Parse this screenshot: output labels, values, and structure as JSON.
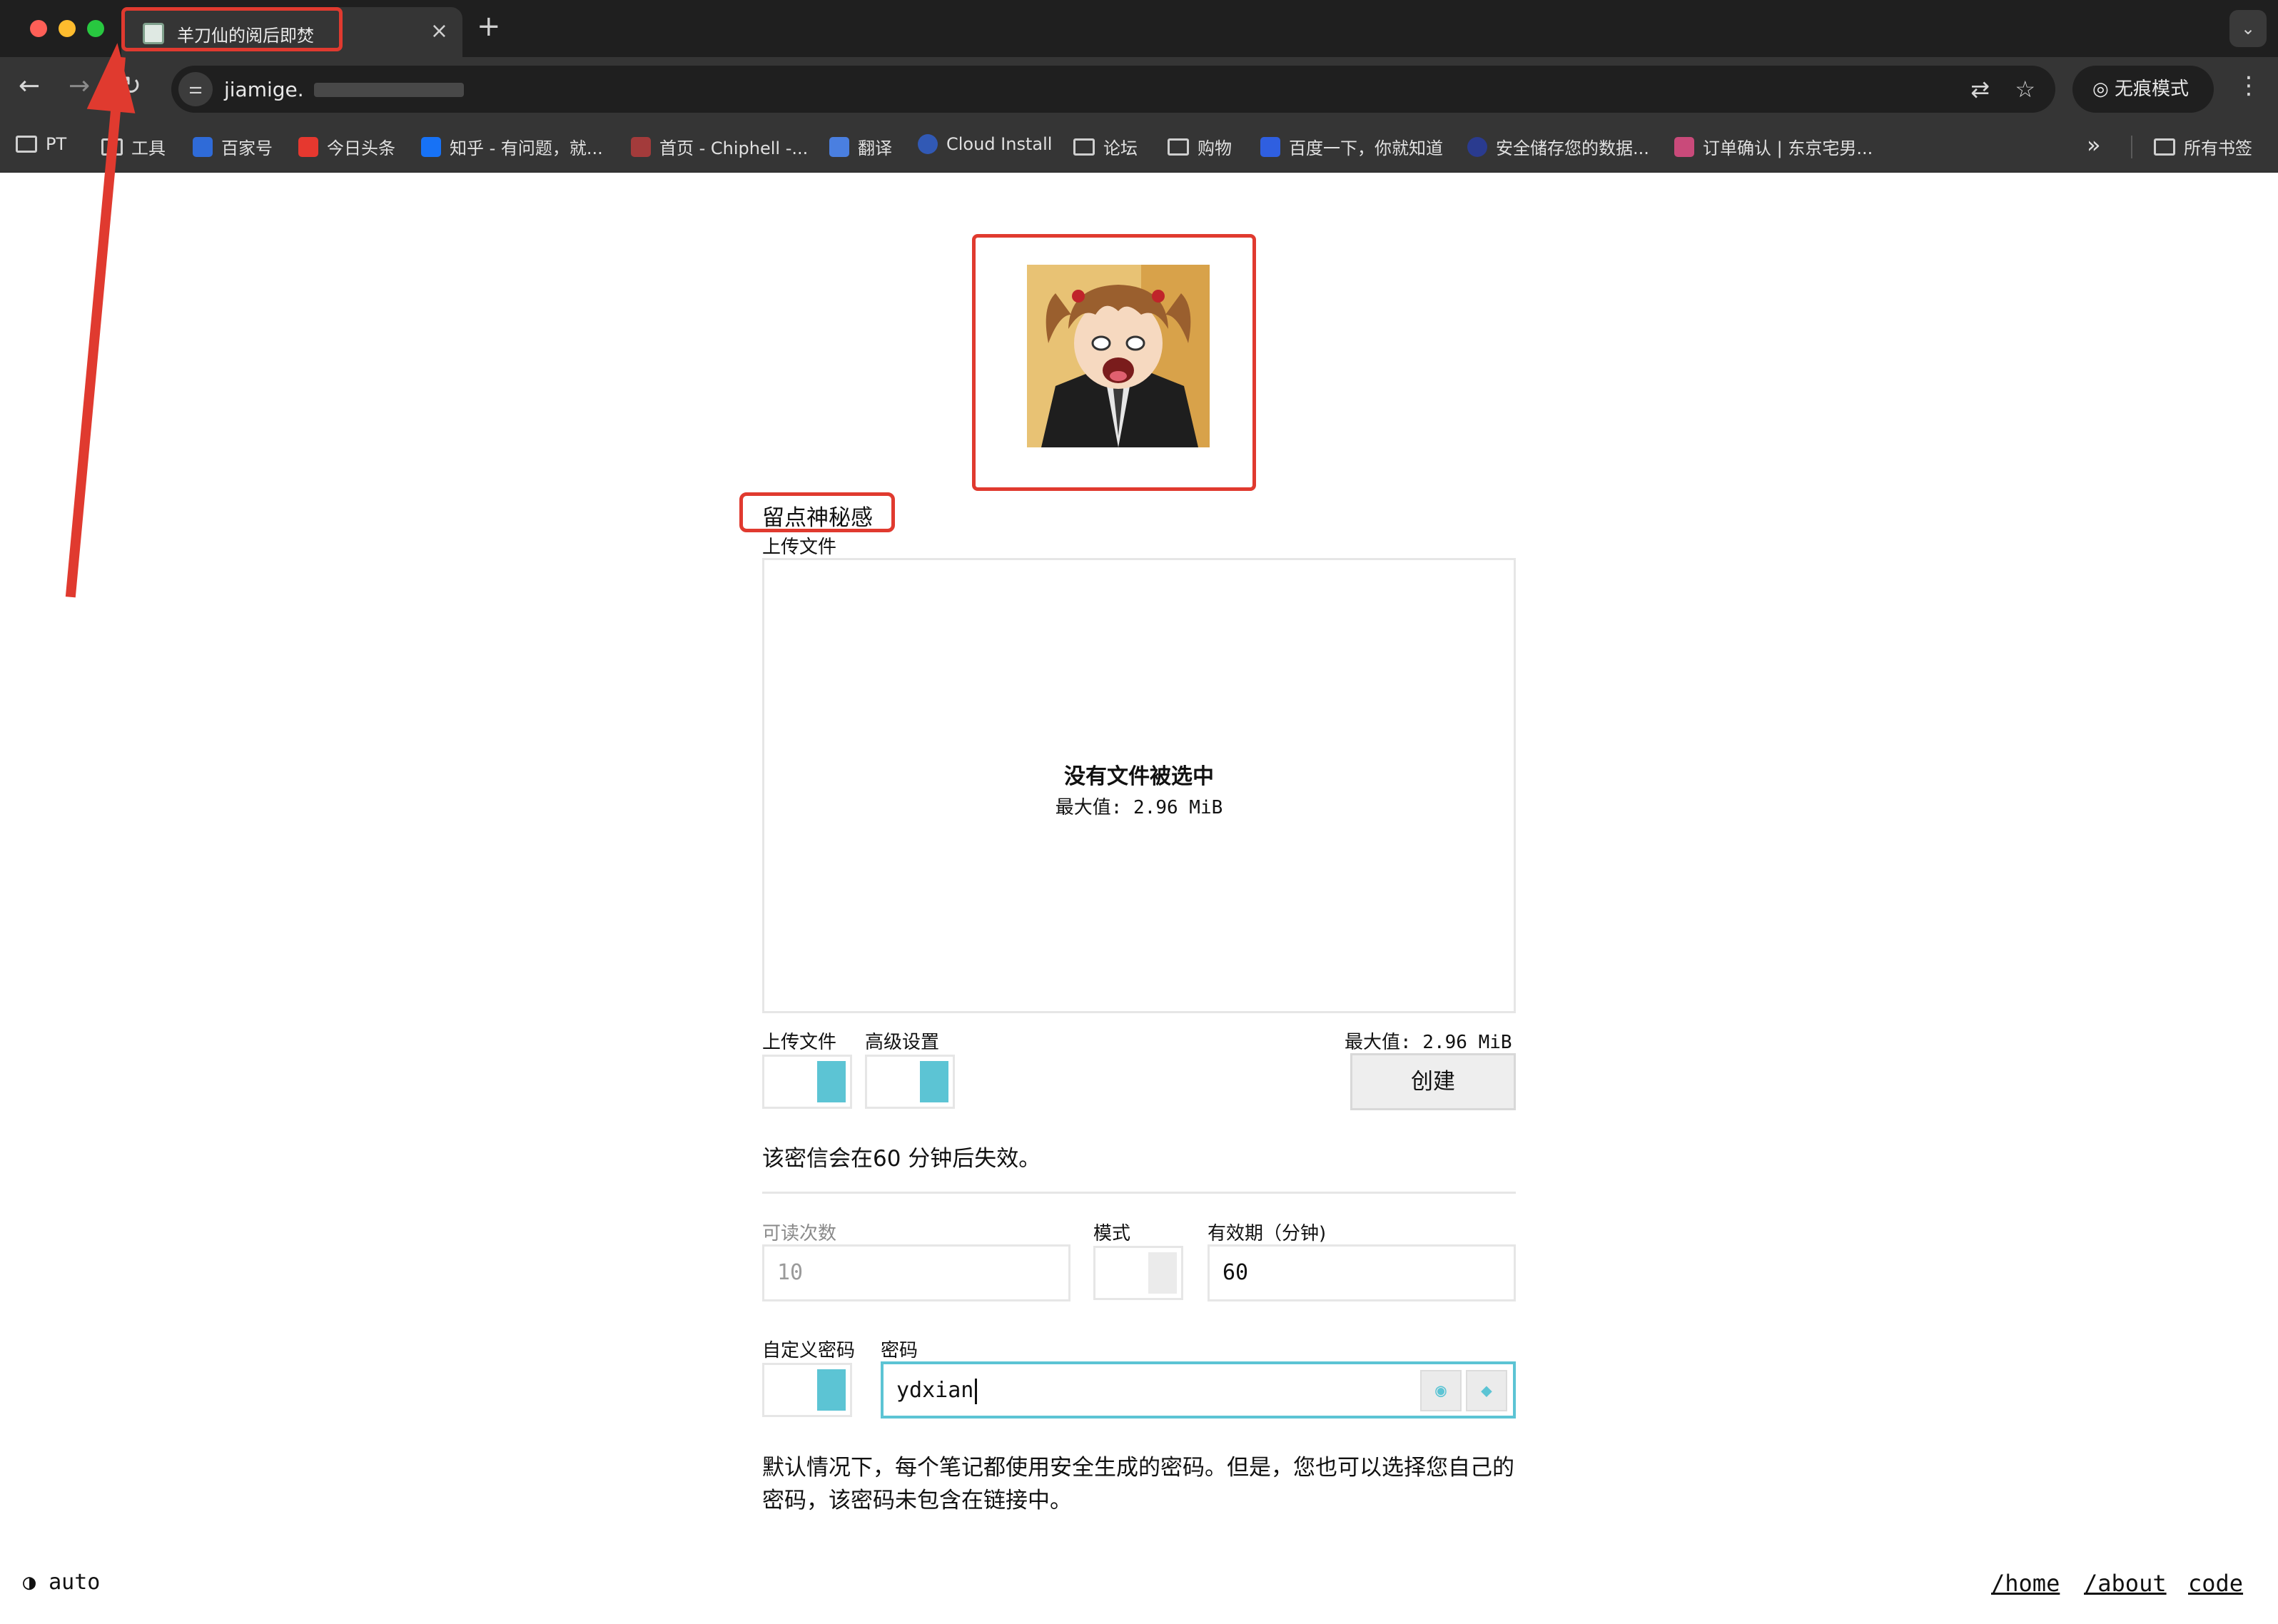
{
  "browser": {
    "tab_title": "羊刀仙的阅后即焚",
    "tab_close": "×",
    "new_tab": "+",
    "url": "jiamige.",
    "incognito_label": "无痕模式",
    "bookmarks": [
      {
        "label": "PT",
        "icon": "folder-icon"
      },
      {
        "label": "工具",
        "icon": "folder-icon"
      },
      {
        "label": "百家号",
        "icon": "baijiahao-icon"
      },
      {
        "label": "今日头条",
        "icon": "toutiao-icon"
      },
      {
        "label": "知乎 - 有问题，就...",
        "icon": "zhihu-icon"
      },
      {
        "label": "首页 - Chiphell -...",
        "icon": "chiphell-icon"
      },
      {
        "label": "翻译",
        "icon": "translate-icon"
      },
      {
        "label": "Cloud Install",
        "icon": "cloud-icon"
      },
      {
        "label": "论坛",
        "icon": "folder-icon"
      },
      {
        "label": "购物",
        "icon": "folder-icon"
      },
      {
        "label": "百度一下，你就知道",
        "icon": "baidu-icon"
      },
      {
        "label": "安全储存您的数据...",
        "icon": "storage-icon"
      },
      {
        "label": "订单确认 | 东京宅男...",
        "icon": "shop-icon"
      }
    ],
    "all_bookmarks": "所有书签"
  },
  "page": {
    "title": "留点神秘感",
    "upload_label": "上传文件",
    "dropzone_title": "没有文件被选中",
    "dropzone_max": "最大值: 2.96 MiB",
    "toggle_upload_label": "上传文件",
    "toggle_advanced_label": "高级设置",
    "max_label": "最大值: 2.96 MiB",
    "create_button": "创建",
    "expire_text": "该密信会在60 分钟后失效。",
    "reads_label": "可读次数",
    "reads_value": "10",
    "mode_label": "模式",
    "expiry_label": "有效期（分钟)",
    "expiry_value": "60",
    "custom_password_label": "自定义密码",
    "password_label": "密码",
    "password_value": "ydxian",
    "description": "默认情况下，每个笔记都使用安全生成的密码。但是，您也可以选择您自己的密码，该密码未包含在链接中。"
  },
  "footer": {
    "theme": "auto",
    "links": [
      "/home",
      "/about",
      "code"
    ]
  },
  "colors": {
    "accent": "#5cc4d4",
    "annotation": "#e03a2f"
  }
}
